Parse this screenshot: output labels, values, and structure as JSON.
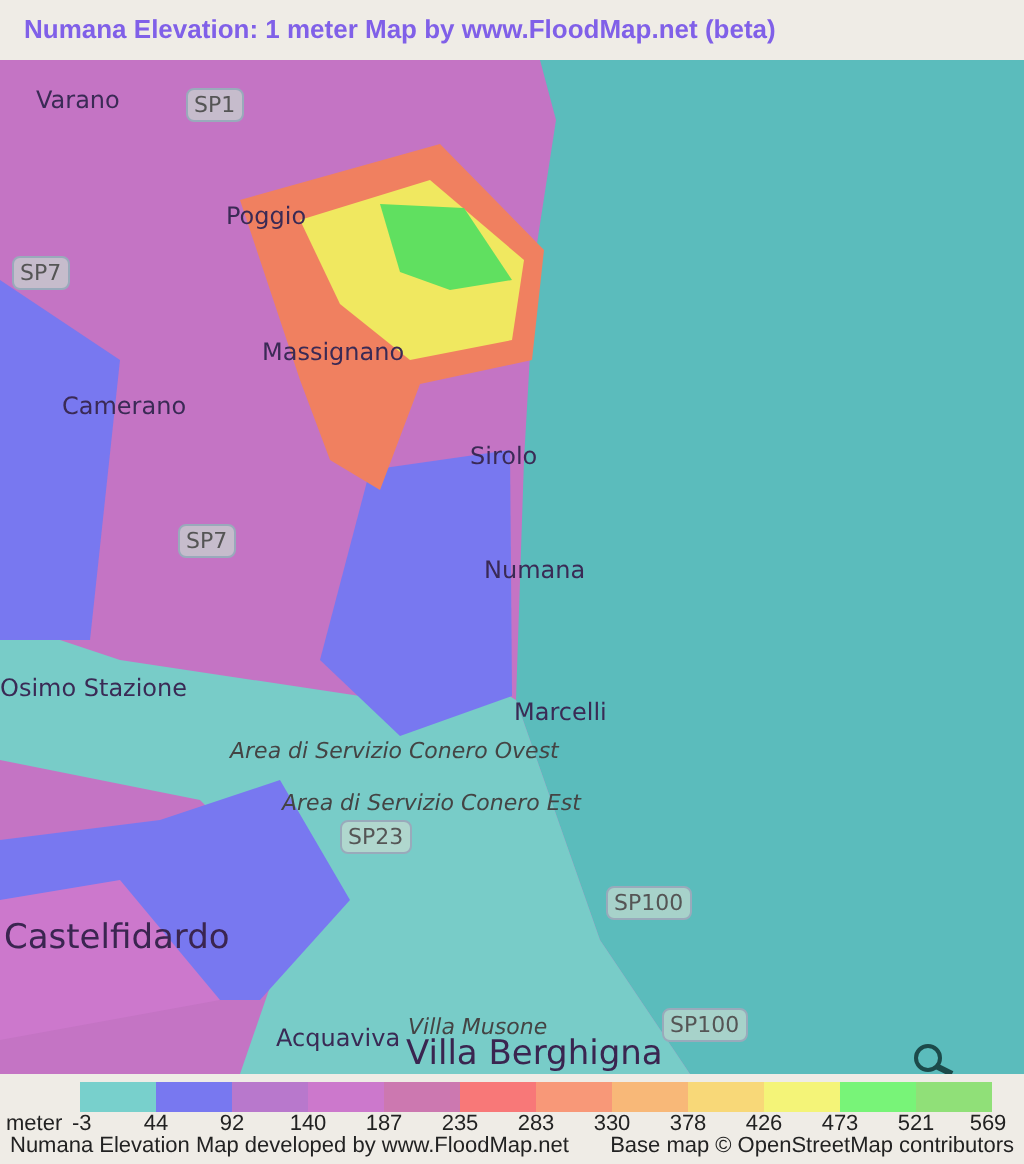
{
  "title": "Numana Elevation: 1 meter Map by www.FloodMap.net (beta)",
  "map": {
    "places": [
      {
        "kind": "place",
        "text": "Varano"
      },
      {
        "kind": "road",
        "text": "SP1"
      },
      {
        "kind": "place",
        "text": "Poggio"
      },
      {
        "kind": "road",
        "text": "SP7"
      },
      {
        "kind": "place",
        "text": "Massignano"
      },
      {
        "kind": "place",
        "text": "Camerano"
      },
      {
        "kind": "place",
        "text": "Sirolo"
      },
      {
        "kind": "road",
        "text": "SP7"
      },
      {
        "kind": "place",
        "text": "Numana"
      },
      {
        "kind": "place",
        "text": "Osimo Stazione"
      },
      {
        "kind": "place",
        "text": "Marcelli"
      },
      {
        "kind": "poi",
        "text": "Area di Servizio Conero Ovest"
      },
      {
        "kind": "poi",
        "text": "Area di Servizio Conero Est"
      },
      {
        "kind": "road",
        "text": "SP23"
      },
      {
        "kind": "town",
        "text": "Castelfidardo"
      },
      {
        "kind": "road",
        "text": "SP100"
      },
      {
        "kind": "road",
        "text": "SP100"
      },
      {
        "kind": "poi",
        "text": "Villa Musone"
      },
      {
        "kind": "place",
        "text": "Acquaviva"
      },
      {
        "kind": "town",
        "text": "Villa Berghigna"
      }
    ]
  },
  "legend": {
    "unit": "meter",
    "swatches": [
      {
        "color": "#78d0cc",
        "label": "-3"
      },
      {
        "color": "#7878f0",
        "label": "44"
      },
      {
        "color": "#b878cc",
        "label": "92"
      },
      {
        "color": "#cc78cc",
        "label": "140"
      },
      {
        "color": "#cc78b0",
        "label": "187"
      },
      {
        "color": "#f87878",
        "label": "235"
      },
      {
        "color": "#f89878",
        "label": "283"
      },
      {
        "color": "#f8b878",
        "label": "330"
      },
      {
        "color": "#f8d878",
        "label": "378"
      },
      {
        "color": "#f4f478",
        "label": "426"
      },
      {
        "color": "#78f478",
        "label": "473"
      },
      {
        "color": "#90e078",
        "label": "521"
      }
    ],
    "last_label": "569"
  },
  "footer": {
    "left": "Numana Elevation Map developed by www.FloodMap.net",
    "right": "Base map © OpenStreetMap contributors"
  }
}
